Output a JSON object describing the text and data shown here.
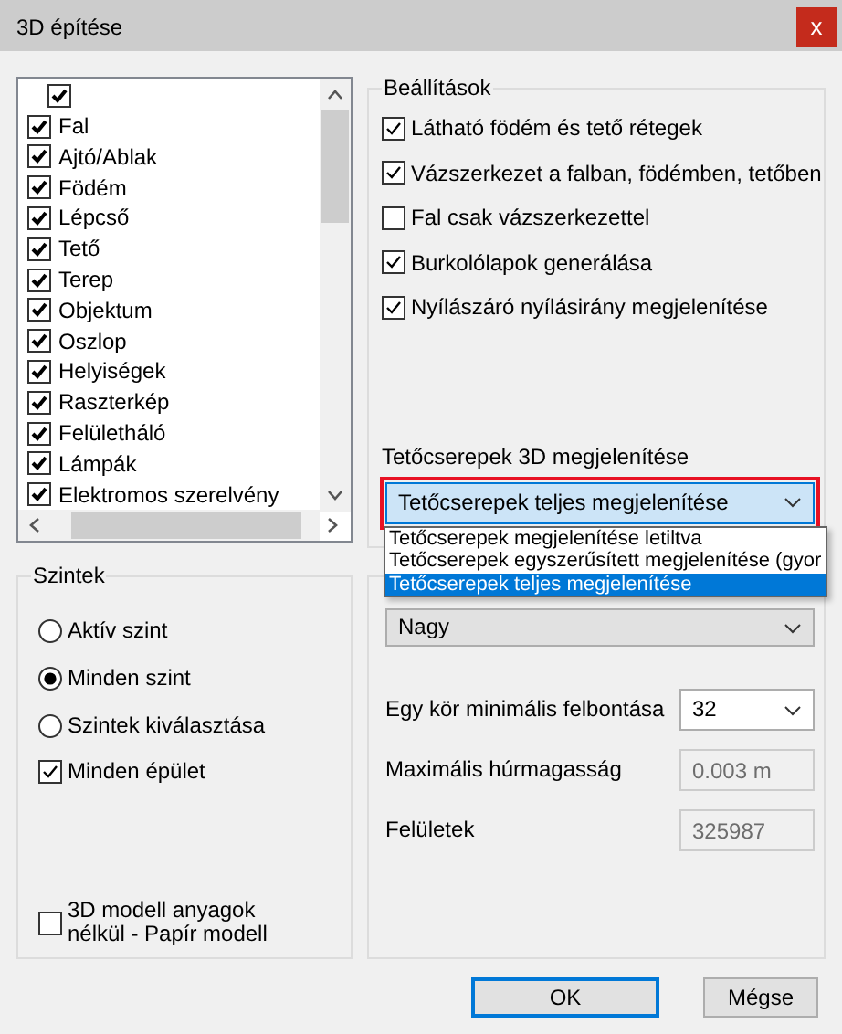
{
  "window": {
    "title": "3D építése",
    "close": "x"
  },
  "layer_list": {
    "select_all": {
      "checked": true
    },
    "items": [
      {
        "label": "Fal",
        "checked": true
      },
      {
        "label": "Ajtó/Ablak",
        "checked": true
      },
      {
        "label": "Födém",
        "checked": true
      },
      {
        "label": "Lépcső",
        "checked": true
      },
      {
        "label": "Tető",
        "checked": true
      },
      {
        "label": "Terep",
        "checked": true
      },
      {
        "label": "Objektum",
        "checked": true
      },
      {
        "label": "Oszlop",
        "checked": true
      },
      {
        "label": "Helyiségek",
        "checked": true
      },
      {
        "label": "Raszterkép",
        "checked": true
      },
      {
        "label": "Felületháló",
        "checked": true
      },
      {
        "label": "Lámpák",
        "checked": true
      },
      {
        "label": "Elektromos szerelvény",
        "checked": true
      }
    ]
  },
  "levels": {
    "title": "Szintek",
    "options": [
      {
        "label": "Aktív szint",
        "selected": false
      },
      {
        "label": "Minden szint",
        "selected": true
      },
      {
        "label": "Szintek kiválasztása",
        "selected": false
      }
    ],
    "all_buildings": {
      "label": "Minden épület",
      "checked": true
    },
    "paper_model": {
      "label": "3D modell anyagok nélkül - Papír modell",
      "checked": false
    }
  },
  "settings": {
    "title": "Beállítások",
    "options": [
      {
        "label": "Látható födém és tető rétegek",
        "checked": true
      },
      {
        "label": "Vázszerkezet a falban, födémben, tetőben",
        "checked": true
      },
      {
        "label": "Fal csak vázszerkezettel",
        "checked": false
      },
      {
        "label": "Burkolólapok generálása",
        "checked": true
      },
      {
        "label": "Nyílászáró nyílásirány megjelenítése",
        "checked": true
      }
    ],
    "roof_tiles": {
      "label": "Tetőcserepek 3D megjelenítése",
      "value": "Tetőcserepek teljes megjelenítése",
      "expanded": true,
      "options": [
        {
          "label": "Tetőcserepek megjelenítése letiltva",
          "selected": false
        },
        {
          "label": "Tetőcserepek egyszerűsített megjelenítése (gyor",
          "selected": false
        },
        {
          "label": "Tetőcserepek teljes megjelenítése",
          "selected": true
        }
      ]
    }
  },
  "quality": {
    "value": "Nagy",
    "min_resolution": {
      "label": "Egy kör minimális felbontása",
      "value": "32"
    },
    "max_chord": {
      "label": "Maximális húrmagasság",
      "value": "0.003 m",
      "disabled": true
    },
    "surfaces": {
      "label": "Felületek",
      "value": "325987",
      "disabled": true
    }
  },
  "buttons": [
    {
      "label": "OK",
      "default": true
    },
    {
      "label": "Mégse",
      "default": false
    }
  ]
}
